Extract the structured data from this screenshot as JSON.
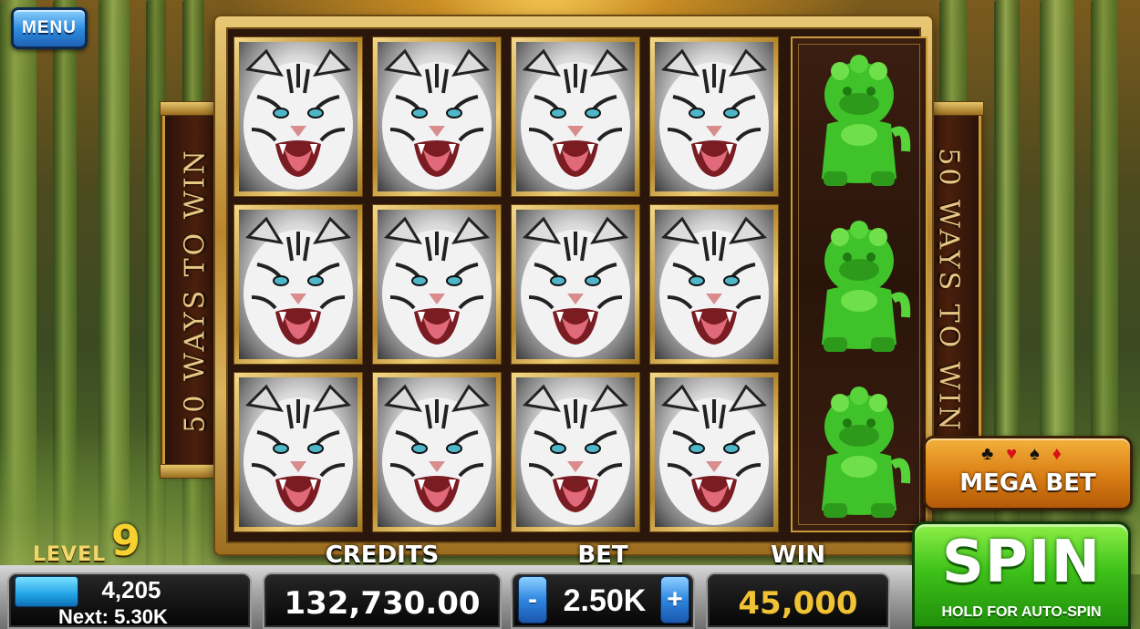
{
  "menu": {
    "label": "MENU"
  },
  "banners": {
    "left": "50 WAYS TO WIN",
    "right": "50 WAYS TO WIN"
  },
  "reels": {
    "columns": [
      [
        "white-tiger",
        "white-tiger",
        "white-tiger"
      ],
      [
        "white-tiger",
        "white-tiger",
        "white-tiger"
      ],
      [
        "white-tiger",
        "white-tiger",
        "white-tiger"
      ],
      [
        "white-tiger",
        "white-tiger",
        "white-tiger"
      ],
      [
        "jade-foo-dog",
        "jade-foo-dog",
        "jade-foo-dog"
      ]
    ]
  },
  "mega_bet": {
    "label": "MEGA BET",
    "suits": [
      "club",
      "heart",
      "spade",
      "diamond"
    ]
  },
  "spin": {
    "label": "SPIN",
    "sublabel": "HOLD FOR AUTO-SPIN"
  },
  "level": {
    "label": "LEVEL",
    "number": "9",
    "xp": "4,205",
    "next": "Next: 5.30K"
  },
  "credits": {
    "label": "CREDITS",
    "value": "132,730.00"
  },
  "bet": {
    "label": "BET",
    "value": "2.50K",
    "minus": "-",
    "plus": "+"
  },
  "win": {
    "label": "WIN",
    "value": "45,000"
  },
  "colors": {
    "jade": "#3fc22a",
    "gold": "#c79a3a",
    "spin_green": "#3fc21a",
    "win_gold": "#f1c233"
  }
}
